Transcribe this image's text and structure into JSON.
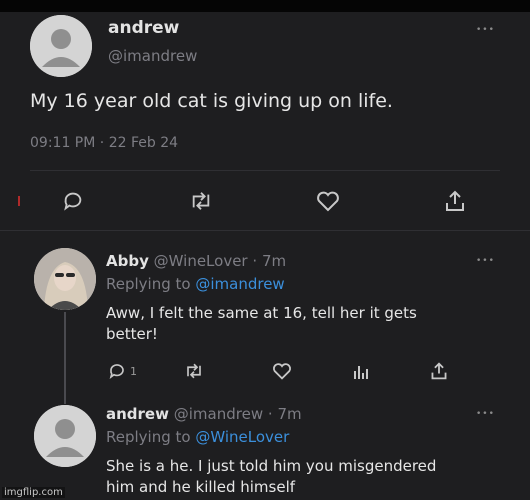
{
  "main_tweet": {
    "name": "andrew",
    "handle": "@imandrew",
    "text": "My 16 year old cat is giving up on life.",
    "time": "09:11 PM",
    "date": "22 Feb 24"
  },
  "reply_1": {
    "name": "Abby",
    "handle": "@WineLover",
    "age": "7m",
    "replying_prefix": "Replying to",
    "replying_to": "@imandrew",
    "text": "Aww, I felt the same at 16, tell her it gets better!",
    "reply_count": "1"
  },
  "reply_2": {
    "name": "andrew",
    "handle": "@imandrew",
    "age": "7m",
    "replying_prefix": "Replying to",
    "replying_to": "@WineLover",
    "text": "She is a he. I just told him you misgendered him and he killed himself"
  },
  "separator": "·",
  "more_glyph": "•••",
  "watermark": "imgflip.com",
  "icons": [
    "reply-icon",
    "retweet-icon",
    "like-icon",
    "share-icon",
    "analytics-icon",
    "more-icon"
  ]
}
